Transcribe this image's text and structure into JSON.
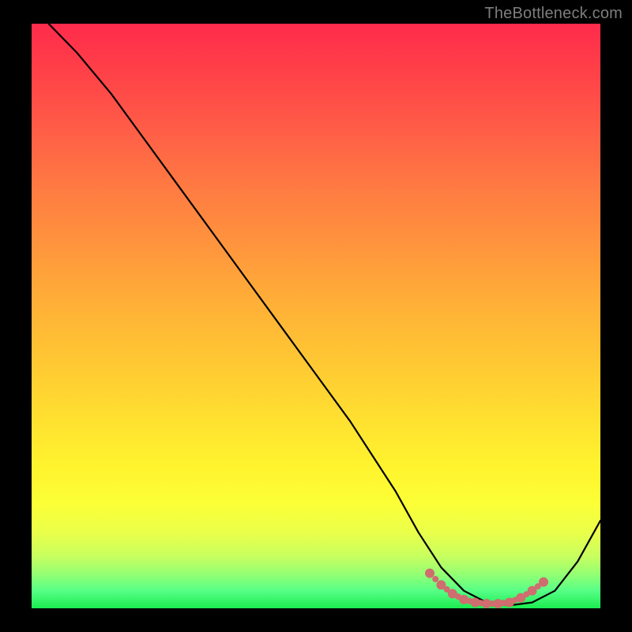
{
  "watermark": "TheBottleneck.com",
  "chart_data": {
    "type": "line",
    "title": "",
    "xlabel": "",
    "ylabel": "",
    "xlim": [
      0,
      100
    ],
    "ylim": [
      0,
      100
    ],
    "grid": false,
    "legend": false,
    "series": [
      {
        "name": "bottleneck-curve",
        "color": "#000000",
        "x": [
          3,
          8,
          14,
          20,
          26,
          32,
          38,
          44,
          50,
          56,
          60,
          64,
          68,
          72,
          76,
          80,
          84,
          88,
          92,
          96,
          100
        ],
        "y": [
          100,
          95,
          88,
          80,
          72,
          64,
          56,
          48,
          40,
          32,
          26,
          20,
          13,
          7,
          3,
          1,
          0.5,
          1,
          3,
          8,
          15
        ]
      },
      {
        "name": "optimal-range-marker",
        "color": "#cf6d6f",
        "style": "dotted-thick",
        "x": [
          70,
          72,
          74,
          76,
          78,
          80,
          82,
          84,
          86,
          88,
          90
        ],
        "y": [
          6.0,
          4.0,
          2.5,
          1.5,
          1.0,
          0.8,
          0.8,
          1.0,
          1.8,
          3.0,
          4.5
        ]
      }
    ],
    "background_gradient": {
      "orientation": "vertical",
      "stops": [
        {
          "pos": 0.0,
          "color": "#ff2b4b"
        },
        {
          "pos": 0.18,
          "color": "#ff5d47"
        },
        {
          "pos": 0.38,
          "color": "#ff953d"
        },
        {
          "pos": 0.58,
          "color": "#ffc833"
        },
        {
          "pos": 0.76,
          "color": "#fff42e"
        },
        {
          "pos": 0.91,
          "color": "#c9ff5e"
        },
        {
          "pos": 1.0,
          "color": "#1bec50"
        }
      ]
    }
  }
}
